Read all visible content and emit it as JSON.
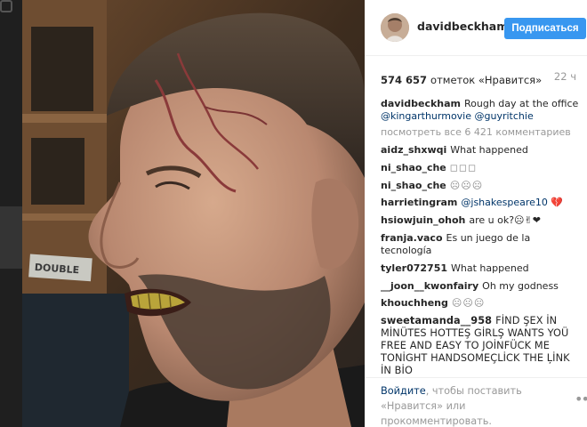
{
  "post": {
    "username": "davidbeckham",
    "follow_label": "Подписаться",
    "likes_count": "574 657",
    "likes_label": "отметок «Нравится»",
    "time_ago": "22 ч",
    "caption": {
      "text": "Rough day at the office",
      "mentions": [
        "@kingarthurmovie",
        "@guyritchie"
      ]
    },
    "view_all_comments": "посмотреть все 6 421 комментариев"
  },
  "comments": [
    {
      "user": "aidz_shxwqi",
      "text": "What happened"
    },
    {
      "user": "ni_shao_che",
      "text": "◻◻◻"
    },
    {
      "user": "ni_shao_che",
      "text": "☹☹☹"
    },
    {
      "user": "harrietingram",
      "text": "@jshakespeare10 💔"
    },
    {
      "user": "hsiowjuin_ohoh",
      "text": "are u ok?☹✌❤"
    },
    {
      "user": "franja.vaco",
      "text": "Es un juego de la tecnología"
    },
    {
      "user": "tyler072751",
      "text": "What happened"
    },
    {
      "user": "__joon__kwonfairy",
      "text": "Oh my godness"
    },
    {
      "user": "khouchheng",
      "text": "☹☹☹"
    },
    {
      "user": "sweetamanda__958",
      "text": "FİND ŞEX İN MİNÜTES HOTTEŞ GİRLŞ WANTS YOÜ FREE AND EASY TO JOİNFÜCK ME TONİGHT HANDSOMEÇLİCK THE ĻİNK İN BİO"
    }
  ],
  "footer": {
    "login_label": "Войдите",
    "rest_text": ", чтобы поставить «Нравится» или прокомментировать.",
    "more_icon": "ellipsis-icon"
  },
  "colors": {
    "follow_button": "#3897f0",
    "mention": "#003569",
    "muted": "#999999"
  }
}
